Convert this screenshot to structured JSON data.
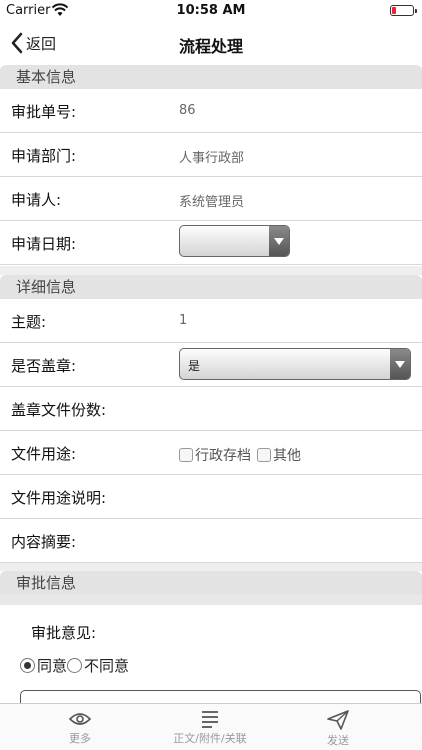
{
  "status_bar": {
    "carrier": "Carrier",
    "time": "10:58 AM"
  },
  "nav": {
    "back_label": "返回",
    "title": "流程处理"
  },
  "sections": {
    "basic": "基本信息",
    "detail": "详细信息",
    "approval": "审批信息"
  },
  "basic_rows": {
    "approval_no": {
      "label": "审批单号:",
      "value": "86"
    },
    "department": {
      "label": "申请部门:",
      "value": "人事行政部"
    },
    "applicant": {
      "label": "申请人:",
      "value": "系统管理员"
    },
    "apply_date": {
      "label": "申请日期:",
      "value": ""
    }
  },
  "detail_rows": {
    "subject": {
      "label": "主题:",
      "value": "1"
    },
    "seal": {
      "label": "是否盖章:",
      "value": "是"
    },
    "copies": {
      "label": "盖章文件份数:"
    },
    "usage": {
      "label": "文件用途:",
      "options": [
        "行政存档",
        "其他"
      ]
    },
    "usage_desc": {
      "label": "文件用途说明:"
    },
    "summary": {
      "label": "内容摘要:"
    }
  },
  "approval": {
    "opinion_label": "审批意见:",
    "options": [
      "同意",
      "不同意"
    ],
    "selected": "同意"
  },
  "tabs": [
    "更多",
    "正文/附件/关联",
    "发送"
  ]
}
